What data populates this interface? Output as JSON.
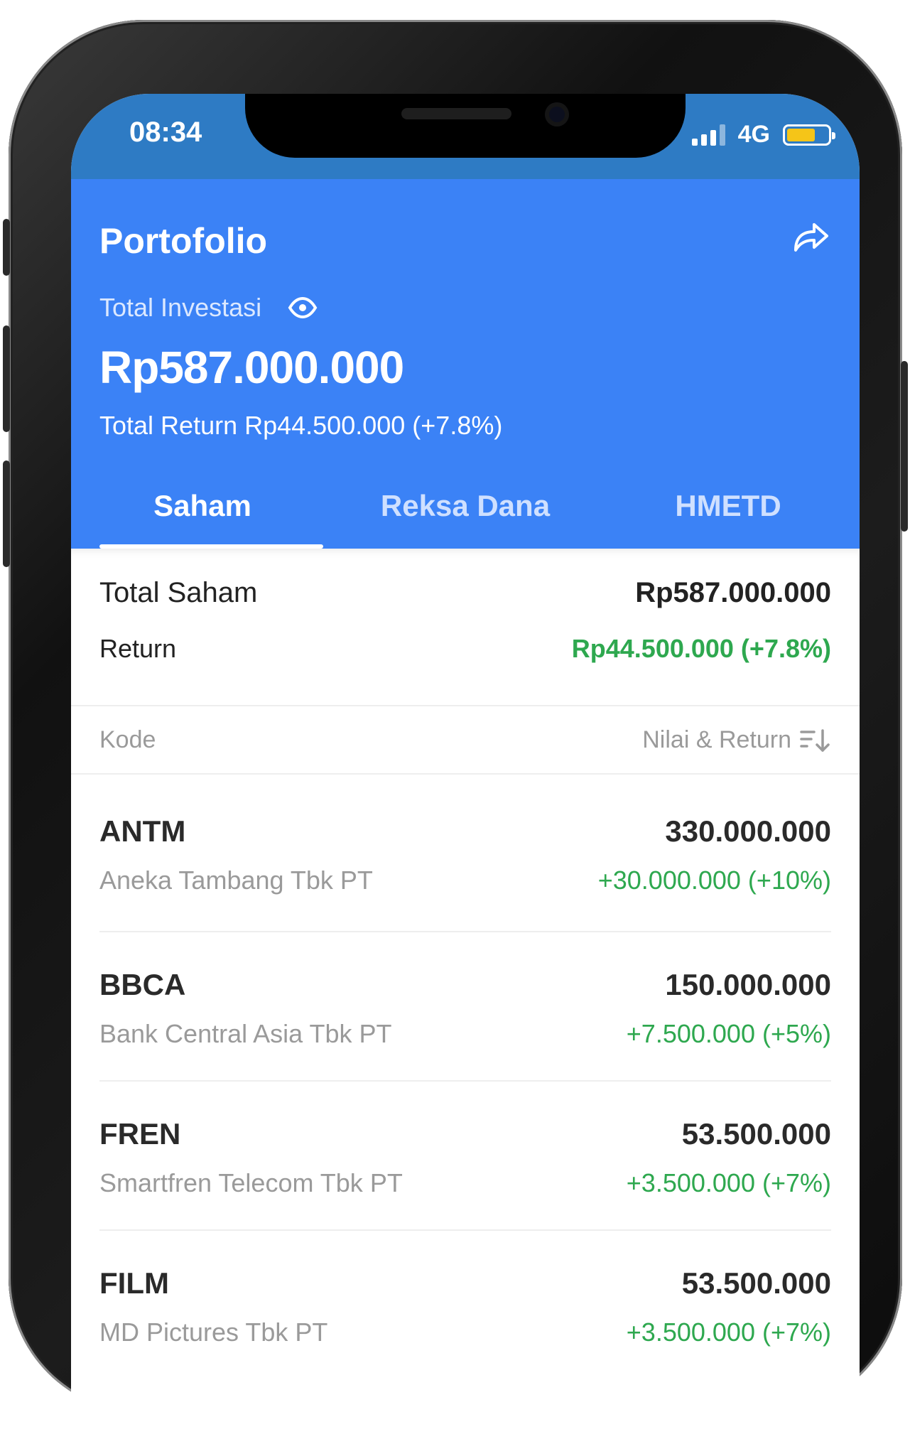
{
  "status_bar": {
    "time": "08:34",
    "network": "4G",
    "battery_color": "#f5c518"
  },
  "header": {
    "title": "Portofolio",
    "share_icon": "share-icon",
    "total_investasi_label": "Total Investasi",
    "eye_icon": "eye-icon",
    "total_amount": "Rp587.000.000",
    "total_return": "Total Return Rp44.500.000 (+7.8%)",
    "background_color": "#3b82f6"
  },
  "tabs": [
    {
      "label": "Saham",
      "active": true
    },
    {
      "label": "Reksa Dana",
      "active": false
    },
    {
      "label": "HMETD",
      "active": false
    }
  ],
  "summary": {
    "total_label": "Total Saham",
    "total_value": "Rp587.000.000",
    "return_label": "Return",
    "return_value": "Rp44.500.000 (+7.8%)",
    "positive_color": "#2ea84f"
  },
  "columns": {
    "left": "Kode",
    "right": "Nilai & Return",
    "sort_icon": "sort-icon"
  },
  "stocks": [
    {
      "code": "ANTM",
      "name": "Aneka Tambang Tbk PT",
      "value": "330.000.000",
      "return": "+30.000.000 (+10%)"
    },
    {
      "code": "BBCA",
      "name": "Bank Central Asia Tbk PT",
      "value": "150.000.000",
      "return": "+7.500.000 (+5%)"
    },
    {
      "code": "FREN",
      "name": "Smartfren Telecom Tbk PT",
      "value": "53.500.000",
      "return": "+3.500.000 (+7%)"
    },
    {
      "code": "FILM",
      "name": "MD Pictures Tbk PT",
      "value": "53.500.000",
      "return": "+3.500.000 (+7%)"
    }
  ]
}
